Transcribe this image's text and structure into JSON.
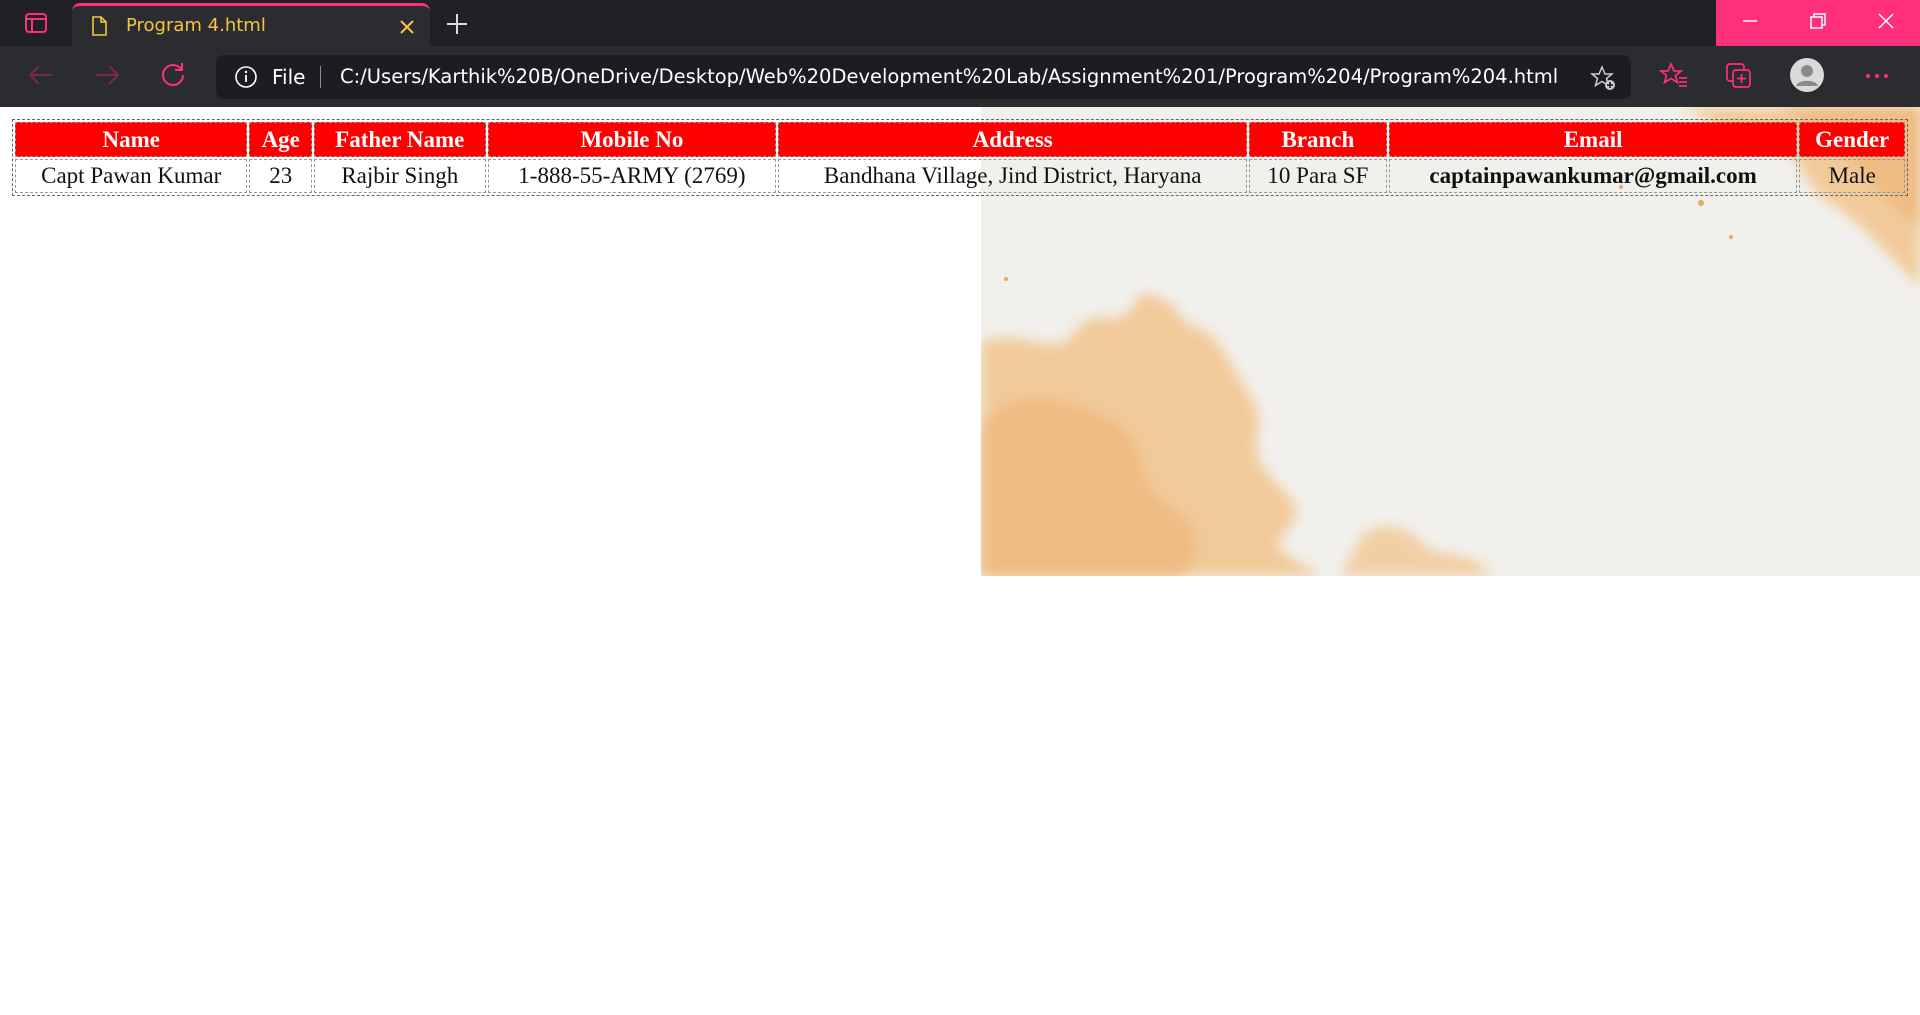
{
  "browser": {
    "tab": {
      "title": "Program 4.html"
    },
    "address": {
      "scheme": "File",
      "url": "C:/Users/Karthik%20B/OneDrive/Desktop/Web%20Development%20Lab/Assignment%201/Program%204/Program%204.html"
    },
    "accent_color": "#ff2f7a",
    "icons": {
      "tab_actions": "tab-actions-icon",
      "tab_page": "page-icon",
      "tab_close": "close-icon",
      "new_tab": "plus-icon",
      "back": "arrow-left-icon",
      "forward": "arrow-right-icon",
      "reload": "reload-icon",
      "site_info": "info-icon",
      "add_favorite": "star-plus-icon",
      "favorites": "favorites-icon",
      "collections": "collections-icon",
      "profile": "avatar-icon",
      "more": "more-icon",
      "minimize": "minimize-icon",
      "restore": "restore-icon",
      "close_window": "close-icon"
    }
  },
  "page": {
    "header_color": "#ff0000",
    "table": {
      "headers": [
        "Name",
        "Age",
        "Father Name",
        "Mobile No",
        "Address",
        "Branch",
        "Email",
        "Gender"
      ],
      "rows": [
        [
          "Capt Pawan Kumar",
          "23",
          "Rajbir Singh",
          "1-888-55-ARMY (2769)",
          "Bandhana Village, Jind District, Haryana",
          "10 Para SF",
          "captainpawankumar@gmail.com",
          "Male"
        ]
      ]
    }
  }
}
